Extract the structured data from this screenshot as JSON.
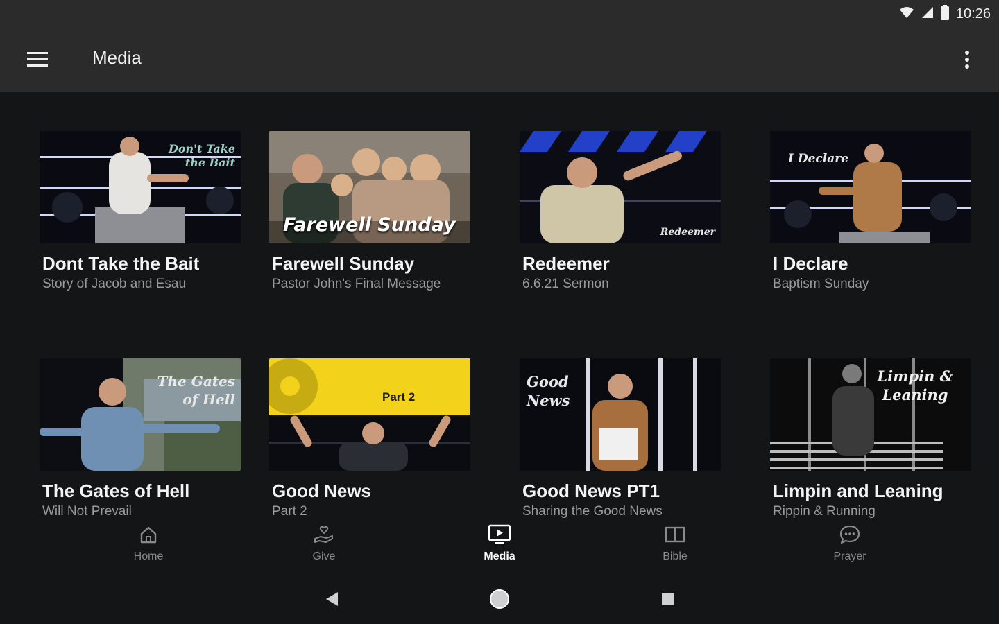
{
  "status": {
    "time": "10:26"
  },
  "app_bar": {
    "title": "Media"
  },
  "media": {
    "items": [
      {
        "title": "Dont Take the Bait",
        "subtitle": "Story of Jacob and Esau",
        "thumb_text": "Don't Take the Bait"
      },
      {
        "title": "Farewell Sunday",
        "subtitle": "Pastor John's Final Message",
        "thumb_text": "Farewell Sunday"
      },
      {
        "title": "Redeemer",
        "subtitle": "6.6.21 Sermon",
        "thumb_text": "Redeemer"
      },
      {
        "title": "I Declare",
        "subtitle": "Baptism Sunday",
        "thumb_text": "I Declare"
      },
      {
        "title": "The Gates of Hell",
        "subtitle": "Will Not Prevail",
        "thumb_text": "The Gates of Hell"
      },
      {
        "title": "Good News",
        "subtitle": "Part 2",
        "thumb_text": "Part 2"
      },
      {
        "title": "Good News PT1",
        "subtitle": "Sharing the Good News",
        "thumb_text": "Good News"
      },
      {
        "title": "Limpin and Leaning",
        "subtitle": "Rippin & Running",
        "thumb_text": "Limpin & Leaning"
      }
    ]
  },
  "bottom_nav": {
    "items": [
      {
        "label": "Home",
        "icon": "home-icon"
      },
      {
        "label": "Give",
        "icon": "give-icon"
      },
      {
        "label": "Media",
        "icon": "media-icon",
        "active": true
      },
      {
        "label": "Bible",
        "icon": "bible-icon"
      },
      {
        "label": "Prayer",
        "icon": "prayer-icon"
      }
    ]
  },
  "colors": {
    "app_bar": "#2b2b2b",
    "background": "#141516",
    "accent_yellow": "#f2d21b",
    "inactive": "#8a8a8a"
  }
}
